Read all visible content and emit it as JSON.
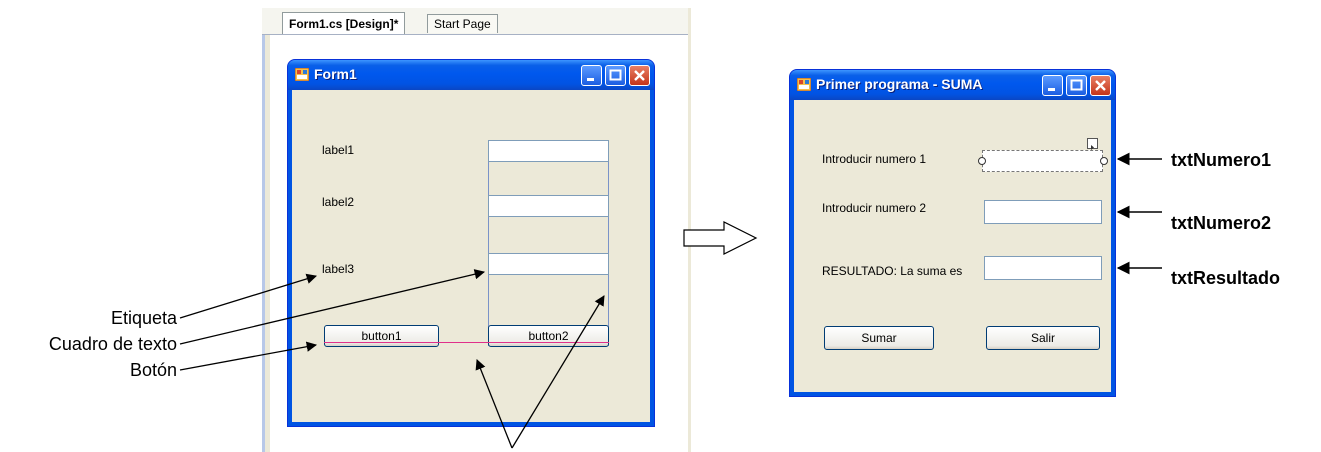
{
  "designer": {
    "tabs": [
      {
        "label": "Form1.cs [Design]*",
        "active": true
      },
      {
        "label": "Start Page",
        "active": false
      }
    ],
    "form": {
      "title": "Form1",
      "labels": [
        "label1",
        "label2",
        "label3"
      ],
      "buttons": [
        "button1",
        "button2"
      ]
    }
  },
  "annotations": {
    "etiqueta": "Etiqueta",
    "cuadro_texto": "Cuadro de texto",
    "boton": "Botón"
  },
  "runtime": {
    "title": "Primer programa - SUMA",
    "label_num1": "Introducir numero 1",
    "label_num2": "Introducir numero 2",
    "label_result": "RESULTADO: La suma es",
    "button_sumar": "Sumar",
    "button_salir": "Salir"
  },
  "control_names": {
    "num1": "txtNumero1",
    "num2": "txtNumero2",
    "result": "txtResultado"
  },
  "colors": {
    "xp_title_blue": "#0054e3",
    "form_face": "#ece9d8",
    "snapline": "#e0308a"
  }
}
